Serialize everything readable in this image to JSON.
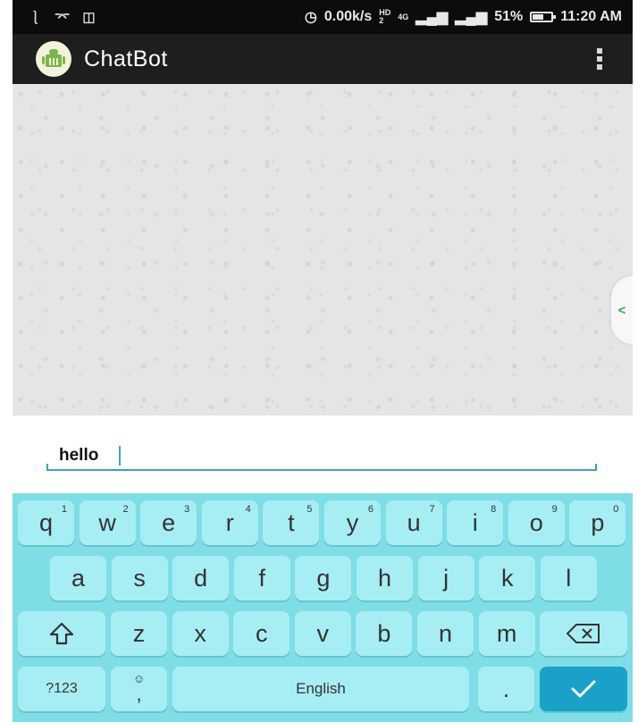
{
  "status_bar": {
    "left_icons": [
      "usb-icon",
      "debug-icon",
      "sync-icon"
    ],
    "data_speed": "0.00k/s",
    "network_small_top": "HD",
    "network_small_bottom": "2",
    "network_type": "4G",
    "battery_percent": "51%",
    "time": "11:20 AM"
  },
  "app_bar": {
    "title": "ChatBot",
    "logo_icon": "android-robot-icon",
    "menu_icon": "overflow-menu-icon"
  },
  "chat": {
    "drawer_handle_icon": "chevron-left-icon",
    "accent_color": "#2db35a"
  },
  "input": {
    "value": "hello",
    "underline_color": "#3aa4c8"
  },
  "keyboard": {
    "row1": [
      {
        "label": "q",
        "hint": "1"
      },
      {
        "label": "w",
        "hint": "2"
      },
      {
        "label": "e",
        "hint": "3"
      },
      {
        "label": "r",
        "hint": "4"
      },
      {
        "label": "t",
        "hint": "5"
      },
      {
        "label": "y",
        "hint": "6"
      },
      {
        "label": "u",
        "hint": "7"
      },
      {
        "label": "i",
        "hint": "8"
      },
      {
        "label": "o",
        "hint": "9"
      },
      {
        "label": "p",
        "hint": "0"
      }
    ],
    "row2": [
      "a",
      "s",
      "d",
      "f",
      "g",
      "h",
      "j",
      "k",
      "l"
    ],
    "row3": [
      "z",
      "x",
      "c",
      "v",
      "b",
      "n",
      "m"
    ],
    "shift_icon": "shift-arrow-icon",
    "backspace_icon": "backspace-icon",
    "symbols_label": "?123",
    "emoji_icon": "emoji-icon",
    "comma_label": ",",
    "space_label": "English",
    "period_label": ".",
    "enter_icon": "checkmark-icon",
    "background_color": "#7fdde6",
    "key_color": "#a6eef3",
    "enter_color": "#1aa1c8"
  }
}
